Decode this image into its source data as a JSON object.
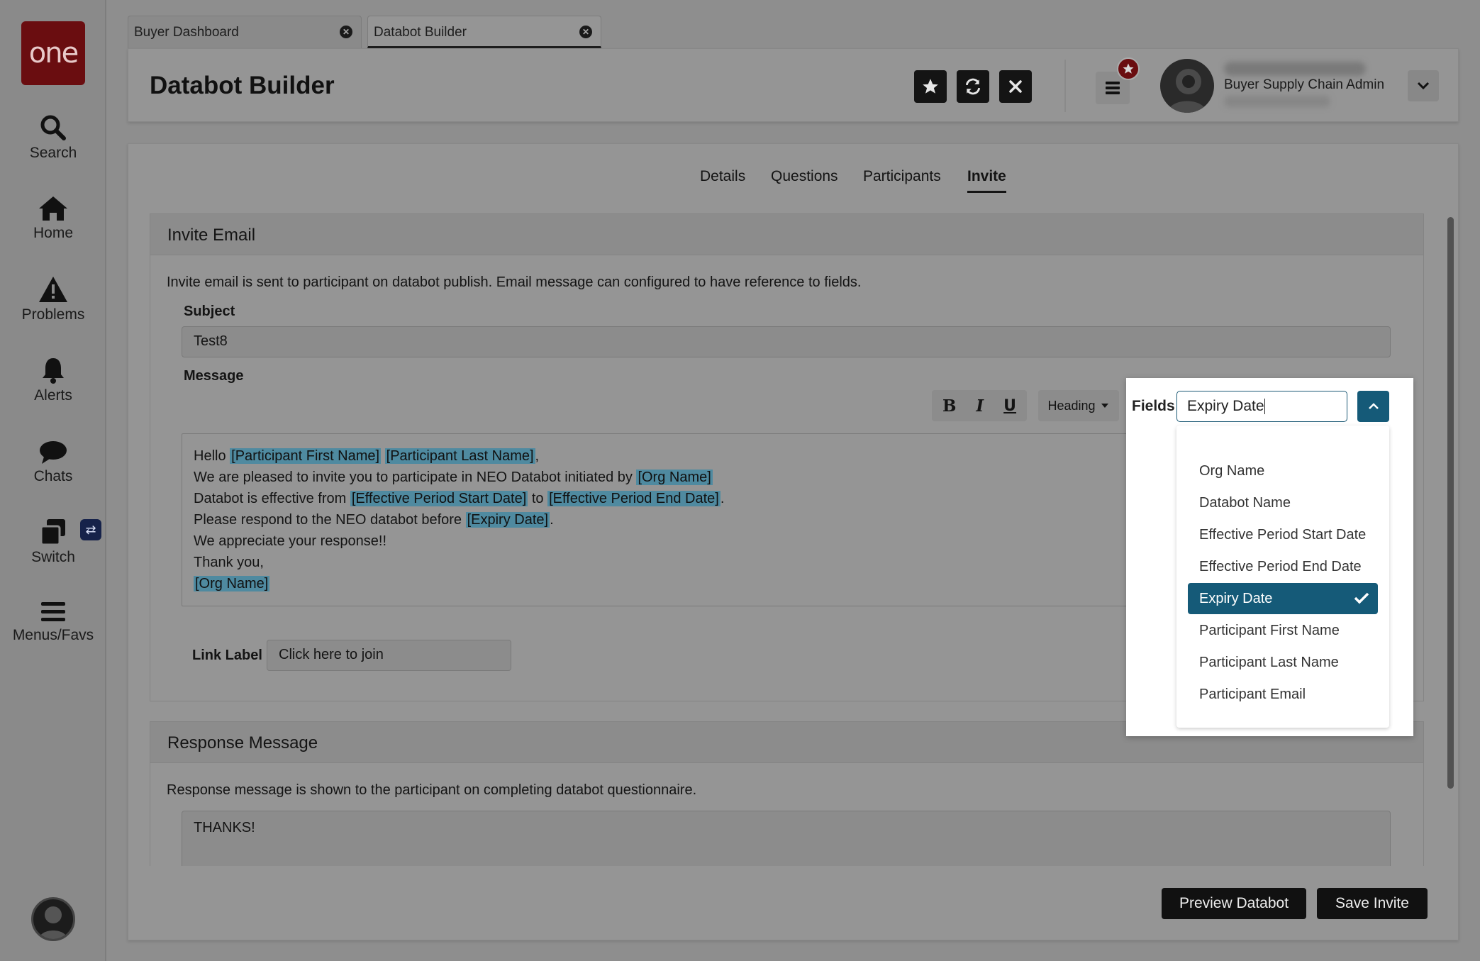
{
  "nav": {
    "logo": "one",
    "items": [
      {
        "label": "Search"
      },
      {
        "label": "Home"
      },
      {
        "label": "Problems"
      },
      {
        "label": "Alerts"
      },
      {
        "label": "Chats"
      },
      {
        "label": "Switch"
      },
      {
        "label": "Menus/Favs"
      }
    ],
    "switch_badge": "⇄"
  },
  "tabs": [
    {
      "label": "Buyer Dashboard"
    },
    {
      "label": "Databot Builder"
    }
  ],
  "header": {
    "title": "Databot Builder",
    "user_role": "Buyer Supply Chain Admin"
  },
  "subtabs": [
    "Details",
    "Questions",
    "Participants",
    "Invite"
  ],
  "invite": {
    "heading": "Invite Email",
    "description": "Invite email is sent to participant on databot publish. Email message can configured to have reference to fields.",
    "subject_label": "Subject",
    "subject_value": "Test8",
    "message_label": "Message",
    "toolbar": {
      "bold": "B",
      "italic": "I",
      "underline": "U",
      "heading": "Heading"
    },
    "message": {
      "l1_a": "Hello ",
      "l1_t1": "[Participant First Name]",
      "l1_b": " ",
      "l1_t2": "[Participant Last Name]",
      "l1_c": ",",
      "l2_a": "We are pleased to invite you to participate in NEO Databot initiated by ",
      "l2_t1": "[Org Name]",
      "l3_a": "Databot is effective from ",
      "l3_t1": "[Effective Period Start Date]",
      "l3_b": " to ",
      "l3_t2": "[Effective Period End Date]",
      "l3_c": ".",
      "l4_a": "Please respond to the NEO databot before ",
      "l4_t1": "[Expiry Date]",
      "l4_b": ".",
      "l5": "We appreciate your response!!",
      "l6": "Thank you,",
      "l7_t1": "[Org Name]"
    },
    "link_label": "Link Label",
    "link_value": "Click here to join"
  },
  "response": {
    "heading": "Response Message",
    "description": "Response message is shown to the participant on completing databot questionnaire.",
    "value": "THANKS!"
  },
  "footer": {
    "preview": "Preview Databot",
    "save": "Save Invite"
  },
  "fields_popover": {
    "label": "Fields",
    "input_value": "Expiry Date",
    "options": [
      "Org Name",
      "Databot Name",
      "Effective Period Start Date",
      "Effective Period End Date",
      "Expiry Date",
      "Participant First Name",
      "Participant Last Name",
      "Participant Email"
    ],
    "selected": "Expiry Date"
  },
  "colors": {
    "brand": "#6a0d10",
    "accent": "#155a78",
    "token_highlight": "#4f8aa0"
  }
}
